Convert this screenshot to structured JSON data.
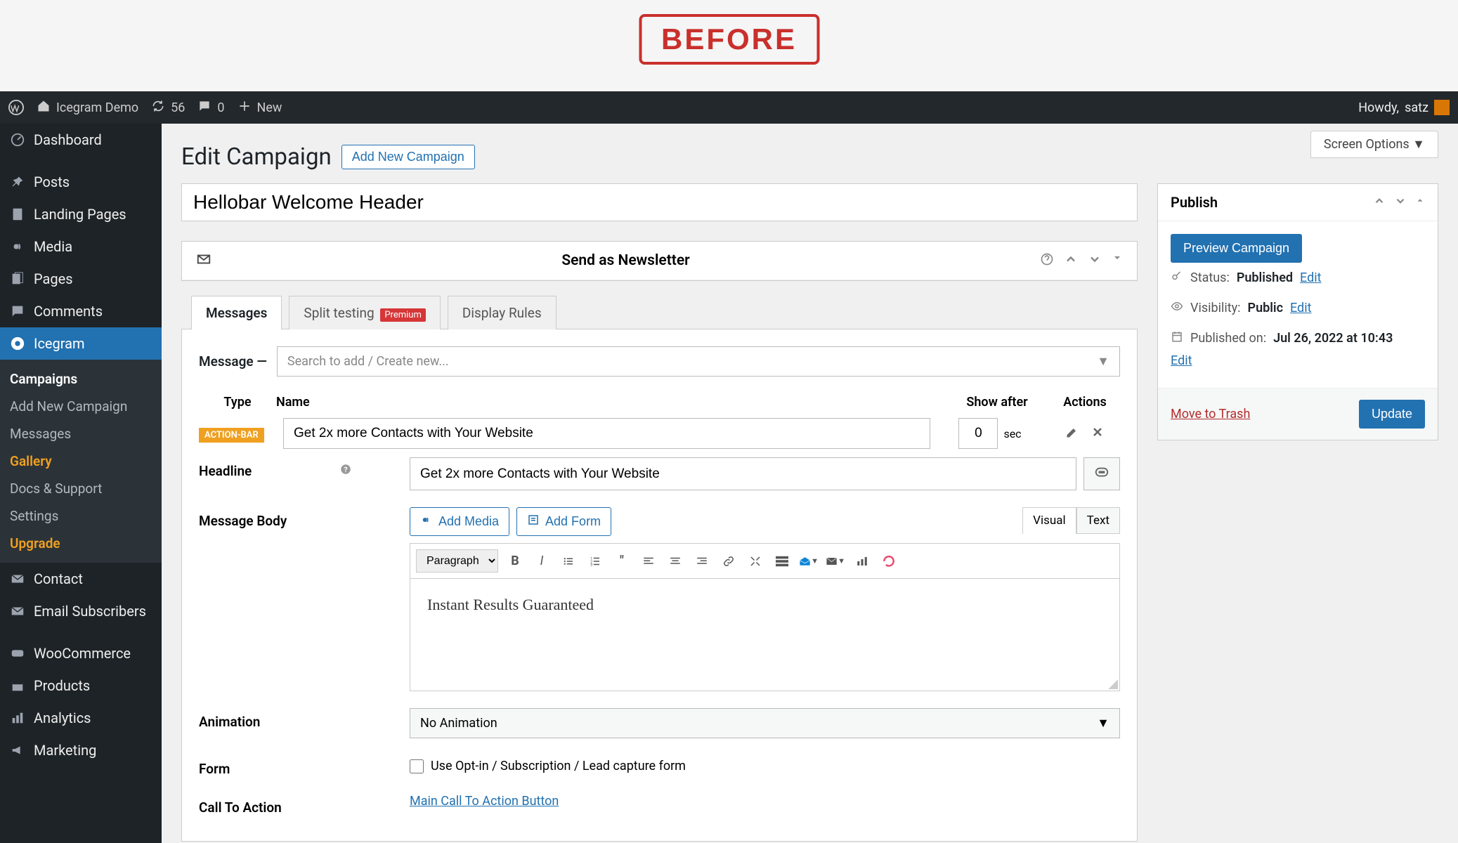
{
  "stamp": "BEFORE",
  "adminbar": {
    "site_name": "Icegram Demo",
    "refresh_count": "56",
    "comments_count": "0",
    "new_label": "New",
    "howdy_prefix": "Howdy, ",
    "user": "satz"
  },
  "sidebar": {
    "items": [
      {
        "label": "Dashboard",
        "icon": "dashboard-icon"
      },
      {
        "label": "Posts",
        "icon": "pin-icon"
      },
      {
        "label": "Landing Pages",
        "icon": "page-icon"
      },
      {
        "label": "Media",
        "icon": "media-icon"
      },
      {
        "label": "Pages",
        "icon": "page-icon"
      },
      {
        "label": "Comments",
        "icon": "comment-icon"
      },
      {
        "label": "Icegram",
        "icon": "icegram-icon",
        "active": true
      },
      {
        "label": "Contact",
        "icon": "mail-icon"
      },
      {
        "label": "Email Subscribers",
        "icon": "mail-icon"
      },
      {
        "label": "WooCommerce",
        "icon": "woo-icon"
      },
      {
        "label": "Products",
        "icon": "box-icon"
      },
      {
        "label": "Analytics",
        "icon": "chart-icon"
      },
      {
        "label": "Marketing",
        "icon": "megaphone-icon"
      }
    ],
    "sub": {
      "items": [
        {
          "label": "Campaigns",
          "current": true
        },
        {
          "label": "Add New Campaign"
        },
        {
          "label": "Messages"
        },
        {
          "label": "Gallery",
          "highlight": true
        },
        {
          "label": "Docs & Support"
        },
        {
          "label": "Settings"
        },
        {
          "label": "Upgrade",
          "highlight": true
        }
      ]
    }
  },
  "screen_options": "Screen Options",
  "page_title": "Edit Campaign",
  "add_new_btn": "Add New Campaign",
  "campaign_title": "Hellobar Welcome Header",
  "newsletter_panel": {
    "title": "Send as Newsletter"
  },
  "tabs": {
    "messages": "Messages",
    "split_testing": "Split testing",
    "split_badge": "Premium",
    "display_rules": "Display Rules"
  },
  "message_section": {
    "label": "Message",
    "search_placeholder": "Search to add / Create new...",
    "columns": {
      "type": "Type",
      "name": "Name",
      "show_after": "Show after",
      "actions": "Actions"
    },
    "type_badge": "ACTION-BAR",
    "name_value": "Get 2x more Contacts with Your Website",
    "show_after_value": "0",
    "show_after_unit": "sec"
  },
  "headline": {
    "label": "Headline",
    "value": "Get 2x more Contacts with Your Website"
  },
  "body": {
    "label": "Message Body",
    "add_media": "Add Media",
    "add_form": "Add Form",
    "visual_tab": "Visual",
    "text_tab": "Text",
    "format": "Paragraph",
    "content": "Instant Results Guaranteed"
  },
  "animation": {
    "label": "Animation",
    "value": "No Animation"
  },
  "form": {
    "label": "Form",
    "checkbox_label": "Use Opt-in / Subscription / Lead capture form"
  },
  "cta": {
    "label": "Call To Action",
    "link": "Main Call To Action Button"
  },
  "publish": {
    "title": "Publish",
    "preview_btn": "Preview Campaign",
    "status_label": "Status:",
    "status_value": "Published",
    "status_edit": "Edit",
    "visibility_label": "Visibility:",
    "visibility_value": "Public",
    "visibility_edit": "Edit",
    "published_label": "Published on:",
    "published_value": "Jul 26, 2022 at 10:43",
    "published_edit": "Edit",
    "trash": "Move to Trash",
    "update": "Update"
  }
}
